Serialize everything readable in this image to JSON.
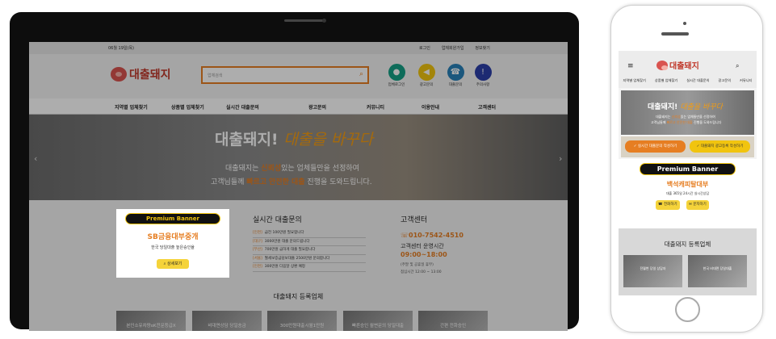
{
  "util": {
    "date": "06월 19일(목)",
    "links": [
      "로그인",
      "업체회원가입",
      "정보찾기"
    ]
  },
  "logo": {
    "text": "대출돼지"
  },
  "search": {
    "placeholder": "업체검색"
  },
  "quick": [
    {
      "label": "업체로그인",
      "color": "#16a085",
      "icon": "user-icon"
    },
    {
      "label": "광고문의",
      "color": "#f1c40f",
      "icon": "megaphone-icon"
    },
    {
      "label": "대출문의",
      "color": "#2980b9",
      "icon": "phone-icon"
    },
    {
      "label": "주의사항",
      "color": "#2c3ea8",
      "icon": "alert-icon"
    }
  ],
  "gnb": [
    "지역별 업체찾기",
    "상품별 업체찾기",
    "실시간 대출문의",
    "광고문의",
    "커뮤니티",
    "이용안내",
    "고객센터"
  ],
  "hero": {
    "title_a": "대출돼지!",
    "title_b": "대출을 바꾸다",
    "line1_a": "대출돼지는",
    "line1_hl": "신뢰성",
    "line1_b": "있는 업체들만을 선정하여",
    "line2_a": "고객님들께",
    "line2_hl1": "빠르고",
    "line2_hl2": "안전한 대출",
    "line2_b": "진행을 도와드립니다."
  },
  "premium": {
    "badge": "Premium Banner",
    "name": "SB금융대부중개",
    "desc": "한국 당일대출 높은승인율",
    "button": "상세보기"
  },
  "realtime": {
    "title": "실시간 대출문의",
    "items": [
      {
        "region": "[인천]",
        "text": "급전 100만원 필요합니다"
      },
      {
        "region": "[대구]",
        "text": "3000만원 대출 문의드립니다"
      },
      {
        "region": "[부산]",
        "text": "700만원 급하게 대출 필요합니다"
      },
      {
        "region": "[서울]",
        "text": "월세보증금담보대출 2500만원 문의합니다"
      },
      {
        "region": "[인천]",
        "text": "300만원 다음달 상환 예정"
      }
    ]
  },
  "cs": {
    "title": "고객센터",
    "phone": "010-7542-4510",
    "hours_label": "고객센터 운영시간",
    "hours": "09:00~18:00",
    "note1": "(주말 및 공휴일 휴무)",
    "note2": "점심시간 12:00 ~ 13:00"
  },
  "registered": {
    "title": "대출돼지 등록업체",
    "cards": [
      "본인소유차량oK전문등급X",
      "비대면상담 당일송금",
      "300만원대출시월1만원",
      "빠른승인 월변문의 당일대출",
      "간편 전화승인"
    ]
  },
  "mobile": {
    "nav": [
      "지역별 업체찾기",
      "상품별 업체찾기",
      "실시간 대출문의",
      "광고문의",
      "커뮤니티"
    ],
    "hero_line1_a": "대출돼지는",
    "hero_line1_hl": "신뢰성",
    "hero_line1_b": "있는 업체들만을 선정하여",
    "hero_line2_a": "고객님들께",
    "hero_line2_hl": "빠르고 안전한 대출",
    "hero_line2_b": "진행을 도와드립니다",
    "btn1": "실시간 대출문의 작성하기",
    "btn2": "대출돼지 광고등록 작성하기",
    "premium_badge": "Premium Banner",
    "premium_name": "백석캐피탈대부",
    "premium_desc": "대출 365일 24시간 실시간상담",
    "call": "전화하기",
    "sms": "문자하기",
    "reg_title": "대출돼지 등록업체",
    "cards": [
      "전월변 당일 상담자",
      "한국 비대면 당일대출"
    ]
  },
  "colors": {
    "accent": "#e67e22",
    "brand": "#c0392b",
    "premium_yellow": "#f1c40f"
  }
}
